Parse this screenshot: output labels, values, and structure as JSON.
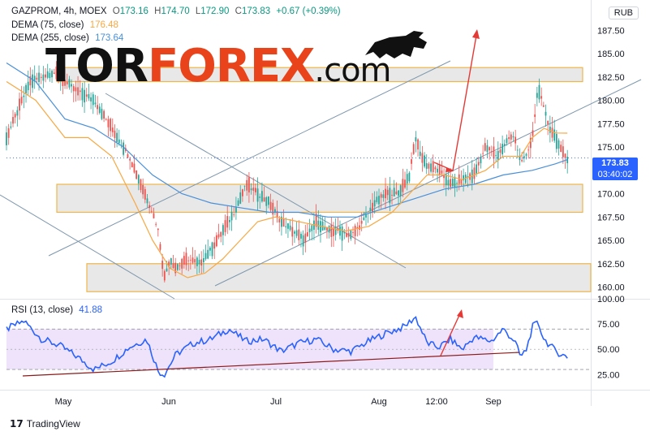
{
  "header": {
    "symbol": "GAZPROM, 4h, MOEX",
    "open_label": "O",
    "open": "173.16",
    "high_label": "H",
    "high": "174.70",
    "low_label": "L",
    "low": "172.90",
    "close_label": "C",
    "close": "173.83",
    "change": "+0.67 (+0.39%)",
    "dema75_label": "DEMA (75, close)",
    "dema75_value": "176.48",
    "dema255_label": "DEMA (255, close)",
    "dema255_value": "173.64",
    "currency": "RUB"
  },
  "price_tag": {
    "price": "173.83",
    "countdown": "03:40:02"
  },
  "watermark": {
    "part1": "TOR",
    "part2": "FOREX",
    "part3": ".com"
  },
  "branding": {
    "tradingview": "TradingView",
    "logo_glyph": "17"
  },
  "rsi_legend": {
    "label": "RSI (13, close)",
    "value": "41.88"
  },
  "colors": {
    "up": "#26a69a",
    "down": "#ef5350",
    "dema75": "#f7a843",
    "dema255": "#4a90d9",
    "rsi": "#2962ff",
    "rsi_band": "#efe3fb",
    "price_tag": "#2962ff",
    "box_fill": "#e4e4e4",
    "box_border": "#f0b64a",
    "trend": "#7e97ad",
    "red_arrow": "#e53935",
    "support": "#8b1a1a"
  },
  "chart_data": [
    {
      "type": "candlestick",
      "x_ticks": [
        "May",
        "Jun",
        "Jul",
        "Aug",
        "12:00",
        "Sep"
      ],
      "y_ticks": [
        "160.00",
        "162.50",
        "165.00",
        "167.50",
        "170.00",
        "172.50",
        "175.00",
        "177.50",
        "180.00",
        "182.50",
        "185.00",
        "187.50"
      ],
      "ylim": [
        159,
        189
      ],
      "close_path": [
        [
          0,
          176
        ],
        [
          4,
          182
        ],
        [
          8,
          183
        ],
        [
          12,
          181
        ],
        [
          15,
          180
        ],
        [
          18,
          177
        ],
        [
          21,
          174
        ],
        [
          23,
          171
        ],
        [
          25,
          168
        ],
        [
          26,
          166
        ],
        [
          27,
          161
        ],
        [
          28,
          163
        ],
        [
          29,
          162
        ],
        [
          31,
          163
        ],
        [
          33,
          162.5
        ],
        [
          35,
          164
        ],
        [
          37,
          166
        ],
        [
          39,
          168
        ],
        [
          41,
          171
        ],
        [
          43,
          170
        ],
        [
          45,
          169
        ],
        [
          47,
          167
        ],
        [
          49,
          166
        ],
        [
          51,
          165
        ],
        [
          53,
          167
        ],
        [
          55,
          166
        ],
        [
          57,
          166
        ],
        [
          59,
          165.5
        ],
        [
          61,
          167
        ],
        [
          63,
          169
        ],
        [
          65,
          170
        ],
        [
          67,
          170
        ],
        [
          69,
          172
        ],
        [
          70,
          176
        ],
        [
          71,
          174
        ],
        [
          72,
          173
        ],
        [
          74,
          172.5
        ],
        [
          76,
          171
        ],
        [
          78,
          171.5
        ],
        [
          80,
          172
        ],
        [
          82,
          175
        ],
        [
          84,
          174
        ],
        [
          86,
          176
        ],
        [
          87,
          176
        ],
        [
          88,
          173.5
        ],
        [
          89,
          174
        ],
        [
          90,
          176
        ],
        [
          91,
          181.5
        ],
        [
          92,
          179
        ],
        [
          93,
          177
        ],
        [
          94,
          176
        ],
        [
          95,
          174.5
        ],
        [
          96,
          173.8
        ]
      ],
      "dema75_path": [
        [
          0,
          182
        ],
        [
          5,
          180
        ],
        [
          10,
          176
        ],
        [
          14,
          176
        ],
        [
          18,
          174
        ],
        [
          22,
          169
        ],
        [
          25,
          165
        ],
        [
          28,
          162
        ],
        [
          31,
          161
        ],
        [
          34,
          161.5
        ],
        [
          37,
          163
        ],
        [
          40,
          165
        ],
        [
          43,
          167
        ],
        [
          46,
          167.5
        ],
        [
          50,
          167
        ],
        [
          54,
          166.5
        ],
        [
          58,
          166
        ],
        [
          62,
          166.5
        ],
        [
          66,
          168
        ],
        [
          69,
          170
        ],
        [
          72,
          172
        ],
        [
          75,
          172
        ],
        [
          78,
          171.5
        ],
        [
          82,
          172.5
        ],
        [
          85,
          174
        ],
        [
          88,
          174
        ],
        [
          90,
          176
        ],
        [
          92,
          177
        ],
        [
          94,
          176.5
        ],
        [
          96,
          176.48
        ]
      ],
      "dema255_path": [
        [
          0,
          184
        ],
        [
          5,
          182
        ],
        [
          10,
          178
        ],
        [
          15,
          177
        ],
        [
          20,
          175
        ],
        [
          25,
          172
        ],
        [
          30,
          170
        ],
        [
          35,
          169
        ],
        [
          40,
          168.5
        ],
        [
          45,
          168
        ],
        [
          50,
          168
        ],
        [
          55,
          167.5
        ],
        [
          60,
          167.5
        ],
        [
          65,
          168.5
        ],
        [
          70,
          169.5
        ],
        [
          75,
          170.5
        ],
        [
          80,
          171
        ],
        [
          85,
          172
        ],
        [
          90,
          172.5
        ],
        [
          94,
          173.2
        ],
        [
          96,
          173.64
        ]
      ],
      "zones": [
        {
          "low": 182,
          "high": 183.5
        },
        {
          "low": 168,
          "high": 171
        },
        {
          "low": 159.5,
          "high": 162.5
        }
      ],
      "last_price": 173.83
    },
    {
      "type": "line",
      "name": "RSI (13, close)",
      "y_ticks": [
        "25.00",
        "50.00",
        "75.00",
        "100.00"
      ],
      "ylim": [
        18,
        100
      ],
      "band": [
        30,
        70
      ],
      "path": [
        [
          0,
          70
        ],
        [
          3,
          78
        ],
        [
          6,
          60
        ],
        [
          9,
          54
        ],
        [
          12,
          43
        ],
        [
          15,
          30
        ],
        [
          18,
          38
        ],
        [
          21,
          52
        ],
        [
          24,
          60
        ],
        [
          26,
          28
        ],
        [
          27,
          25
        ],
        [
          29,
          45
        ],
        [
          32,
          56
        ],
        [
          35,
          60
        ],
        [
          38,
          70
        ],
        [
          41,
          58
        ],
        [
          44,
          60
        ],
        [
          47,
          48
        ],
        [
          50,
          56
        ],
        [
          53,
          60
        ],
        [
          56,
          50
        ],
        [
          59,
          48
        ],
        [
          62,
          58
        ],
        [
          65,
          66
        ],
        [
          68,
          72
        ],
        [
          70,
          82
        ],
        [
          72,
          56
        ],
        [
          74,
          52
        ],
        [
          76,
          60
        ],
        [
          78,
          50
        ],
        [
          80,
          62
        ],
        [
          83,
          58
        ],
        [
          85,
          70
        ],
        [
          87,
          58
        ],
        [
          88,
          42
        ],
        [
          89,
          50
        ],
        [
          90,
          72
        ],
        [
          91,
          76
        ],
        [
          92,
          60
        ],
        [
          94,
          48
        ],
        [
          96,
          41.88
        ]
      ],
      "last_value": 41.88
    }
  ]
}
